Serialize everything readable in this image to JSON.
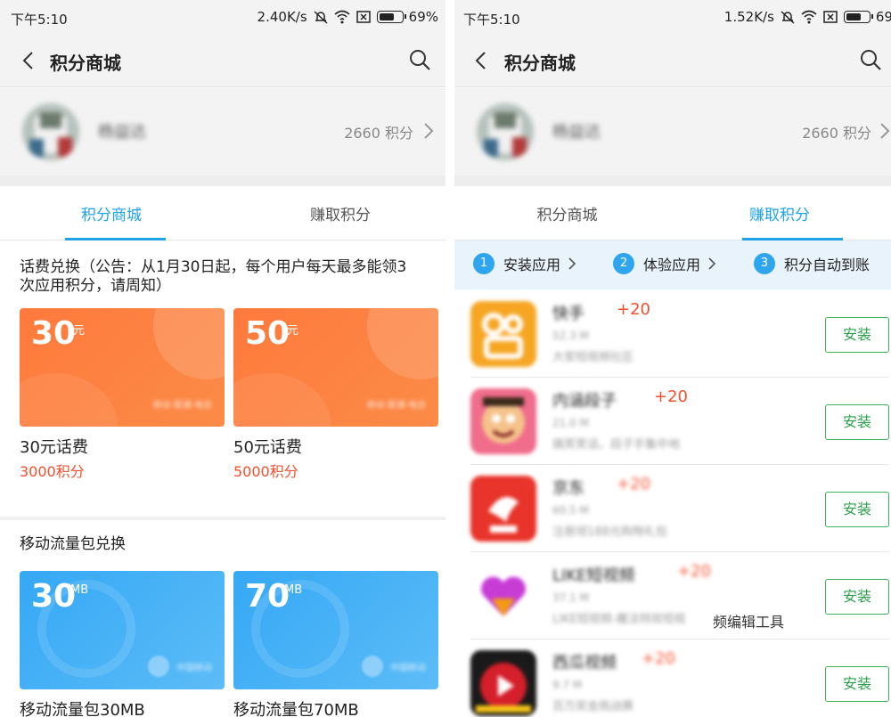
{
  "colors": {
    "accent": "#1fa3e8",
    "price": "#f2502d",
    "install": "#2aa04b",
    "orange_card": "#ff7a3c",
    "blue_card": "#35a8f5"
  },
  "left": {
    "status": {
      "time": "下午5:10",
      "speed": "2.40K/s",
      "battery": "69%",
      "battery_level": 0.69
    },
    "header": {
      "title": "积分商城",
      "back_icon": "chevron-left-icon",
      "search_icon": "search-icon"
    },
    "profile": {
      "username": "杨益达",
      "points": "2660 积分"
    },
    "tabs": [
      {
        "label": "积分商城"
      },
      {
        "label": "赚取积分"
      }
    ],
    "section_phone": {
      "title_line1": "话费兑换（公告：从1月30日起，每个用户每天最多能领3",
      "title_line2": "次应用积分，请周知）"
    },
    "phone_cards": [
      {
        "amount": "30",
        "unit": "元",
        "tiny": "移动·联通·电信",
        "name": "30元话费",
        "price": "3000积分"
      },
      {
        "amount": "50",
        "unit": "元",
        "tiny": "移动·联通·电信",
        "name": "50元话费",
        "price": "5000积分"
      }
    ],
    "section_data": {
      "title": "移动流量包兑换"
    },
    "data_cards": [
      {
        "amount": "30",
        "unit": "MB",
        "tiny": "中国移动",
        "name": "移动流量包30MB"
      },
      {
        "amount": "70",
        "unit": "MB",
        "tiny": "中国移动",
        "name": "移动流量包70MB"
      }
    ]
  },
  "right": {
    "status": {
      "time": "下午5:10",
      "speed": "1.52K/s",
      "battery": "69",
      "battery_level": 0.69
    },
    "header": {
      "title": "积分商城"
    },
    "profile": {
      "username": "杨益达",
      "points": "2660 积分"
    },
    "tabs": [
      {
        "label": "积分商城"
      },
      {
        "label": "赚取积分"
      }
    ],
    "steps": [
      {
        "num": "1",
        "label": "安装应用"
      },
      {
        "num": "2",
        "label": "体验应用"
      },
      {
        "num": "3",
        "label": "积分自动到账"
      }
    ],
    "apps": [
      {
        "name": "快手",
        "bonus": "+20",
        "size": "52.3 M",
        "desc": "大家短视频社区",
        "install": "安装",
        "icon_color": "#f6a623"
      },
      {
        "name": "内涵段子",
        "bonus": "+20",
        "size": "21.0 M",
        "desc": "搞笑笑话，段子手集中地",
        "install": "安装",
        "icon_color": "#f06d8c"
      },
      {
        "name": "京东",
        "bonus": "+20",
        "size": "60.5 M",
        "desc": "注册领188元购物礼包",
        "install": "安装",
        "icon_color": "#e8342a"
      },
      {
        "name": "LIKE短视频",
        "bonus": "+20",
        "size": "37.1 M",
        "desc": "LIKE短视频-魔法特效短视",
        "desc_clear": "频编辑工具",
        "install": "安装",
        "icon_color": "#c83cd6"
      },
      {
        "name": "西瓜视频",
        "bonus": "+20",
        "size": "9.7 M",
        "desc": "百万奖金挑战赛",
        "install": "安装",
        "icon_color": "#d51f2a"
      }
    ]
  }
}
